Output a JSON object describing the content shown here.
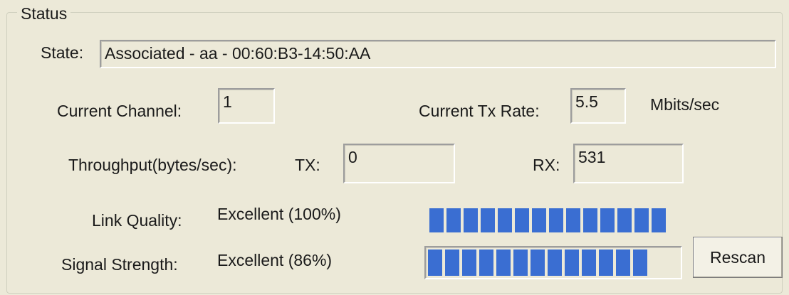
{
  "status": {
    "group_title": "Status",
    "state_label": "State:",
    "state_value": "Associated - aa - 00:60:B3-14:50:AA",
    "channel_label": "Current Channel:",
    "channel_value": "1",
    "tx_rate_label": "Current Tx Rate:",
    "tx_rate_value": "5.5",
    "tx_rate_unit": "Mbits/sec",
    "throughput_label": "Throughput(bytes/sec):",
    "tx_label": "TX:",
    "tx_value": "0",
    "rx_label": "RX:",
    "rx_value": "531",
    "link_quality_label": "Link Quality:",
    "link_quality_value": "Excellent (100%)",
    "link_quality_percent": 100,
    "signal_strength_label": "Signal Strength:",
    "signal_strength_value": "Excellent (86%)",
    "signal_strength_percent": 86,
    "rescan_label": "Rescan"
  },
  "colors": {
    "background": "#ece9d8",
    "bar_segment": "#3a6ed2"
  }
}
